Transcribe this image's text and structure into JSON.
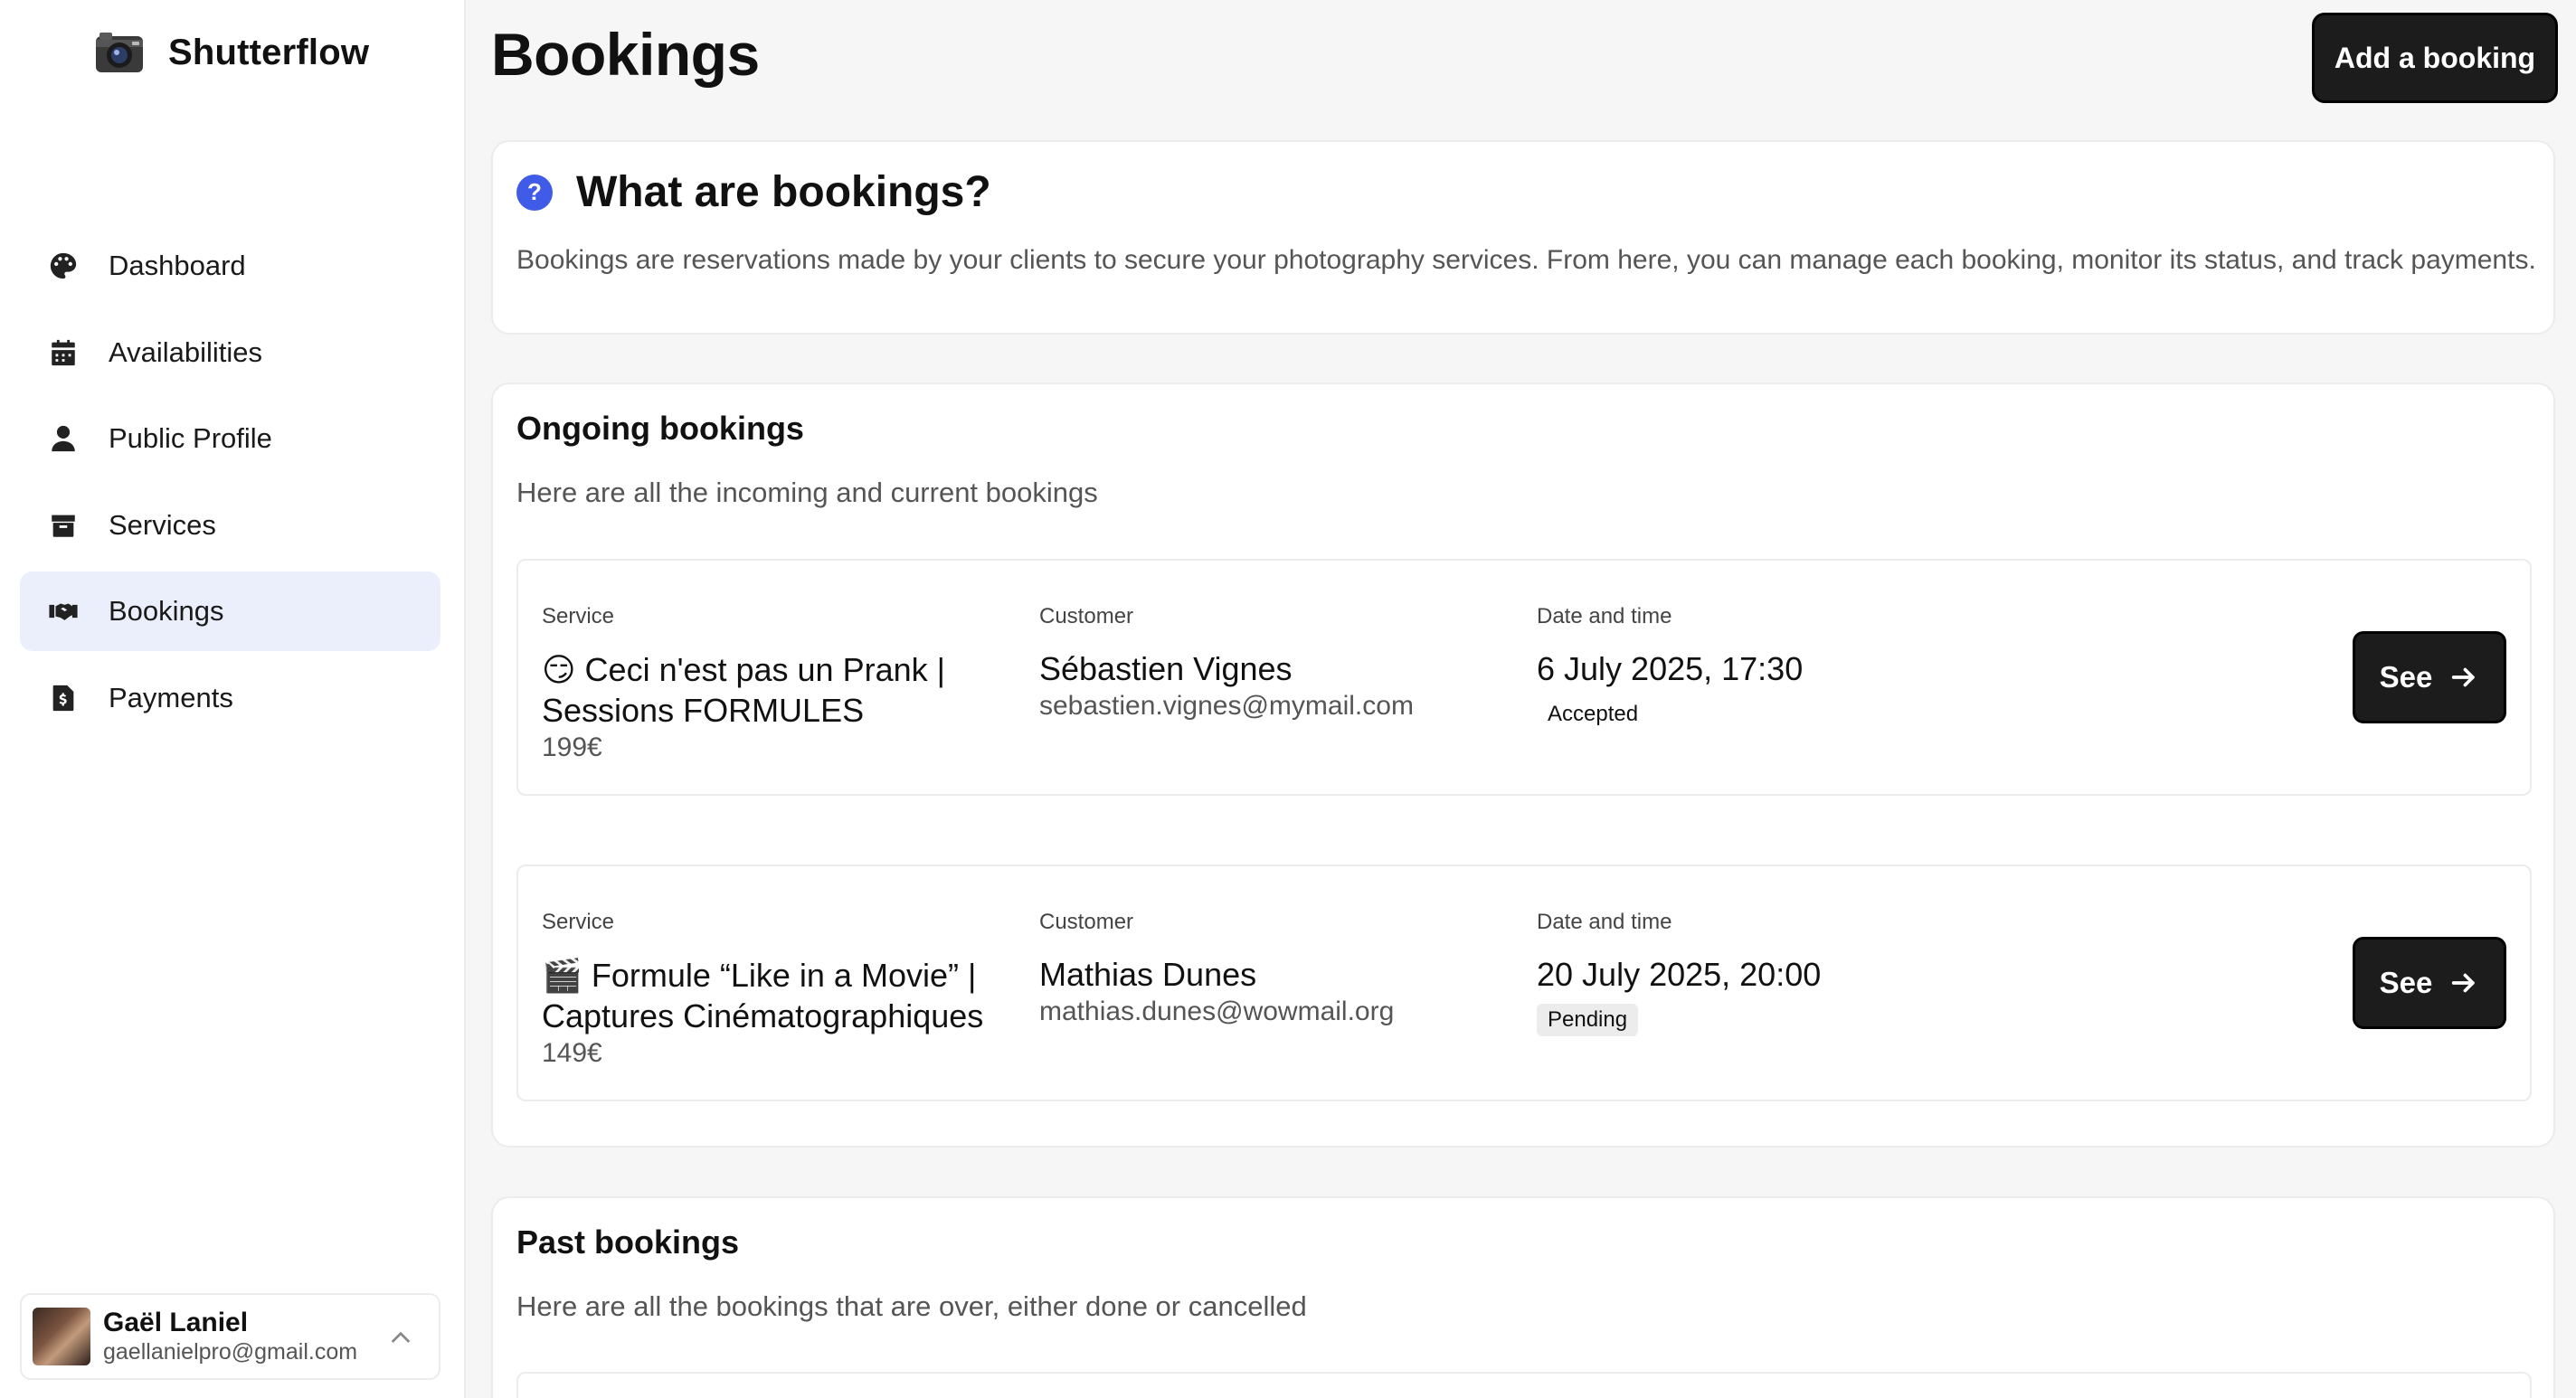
{
  "sidebar": {
    "brand": "Shutterflow",
    "items": [
      {
        "label": "Dashboard",
        "icon": "palette-icon"
      },
      {
        "label": "Availabilities",
        "icon": "calendar-icon"
      },
      {
        "label": "Public Profile",
        "icon": "user-icon"
      },
      {
        "label": "Services",
        "icon": "box-icon"
      },
      {
        "label": "Bookings",
        "icon": "handshake-icon",
        "active": true
      },
      {
        "label": "Payments",
        "icon": "invoice-icon"
      }
    ],
    "user": {
      "name": "Gaël Laniel",
      "email": "gaellanielpro@gmail.com"
    }
  },
  "header": {
    "title": "Bookings",
    "add_button": "Add a booking"
  },
  "info": {
    "icon_char": "?",
    "title": "What are bookings?",
    "description": "Bookings are reservations made by your clients to secure your photography services. From here, you can manage each booking, monitor its status, and track payments."
  },
  "ongoing": {
    "title": "Ongoing bookings",
    "subtitle": "Here are all the incoming and current bookings",
    "labels": {
      "service": "Service",
      "customer": "Customer",
      "date": "Date and time"
    },
    "bookings": [
      {
        "service_emoji": "😏",
        "service_name": "Ceci n'est pas un Prank | Sessions FORMULES",
        "price": "199€",
        "customer_name": "Sébastien Vignes",
        "customer_email": "sebastien.vignes@mymail.com",
        "date": "6 July 2025, 17:30",
        "status": "Accepted",
        "button": "See"
      },
      {
        "service_emoji": "🎬",
        "service_name": "Formule “Like in a Movie” | Captures Cinématographiques",
        "price": "149€",
        "customer_name": "Mathias Dunes",
        "customer_email": "mathias.dunes@wowmail.org",
        "date": "20 July 2025, 20:00",
        "status": "Pending",
        "button": "See"
      }
    ]
  },
  "past": {
    "title": "Past bookings",
    "subtitle": "Here are all the bookings that are over, either done or cancelled"
  },
  "colors": {
    "accent": "#3f5be8",
    "active_nav_bg": "#ebeefb",
    "button_bg": "#1c1c1c"
  }
}
